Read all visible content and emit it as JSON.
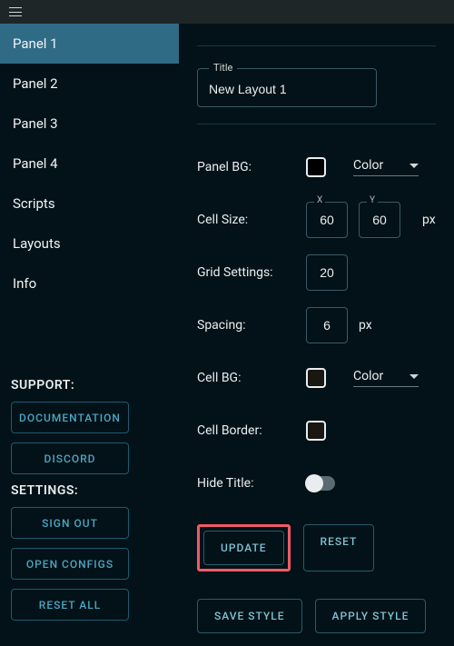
{
  "topbar": {
    "menu_icon": "hamburger-icon"
  },
  "sidebar": {
    "nav": [
      {
        "label": "Panel 1",
        "active": true
      },
      {
        "label": "Panel 2",
        "active": false
      },
      {
        "label": "Panel 3",
        "active": false
      },
      {
        "label": "Panel 4",
        "active": false
      },
      {
        "label": "Scripts",
        "active": false
      },
      {
        "label": "Layouts",
        "active": false
      },
      {
        "label": "Info",
        "active": false
      }
    ],
    "support": {
      "heading": "SUPPORT:",
      "buttons": [
        "DOCUMENTATION",
        "DISCORD"
      ]
    },
    "settings": {
      "heading": "SETTINGS:",
      "buttons": [
        "SIGN OUT",
        "OPEN CONFIGS",
        "RESET ALL"
      ]
    }
  },
  "form": {
    "title_legend": "Title",
    "title_value": "New Layout 1",
    "panel_bg": {
      "label": "Panel BG:",
      "swatch": "#000000",
      "mode": "Color"
    },
    "cell_size": {
      "label": "Cell Size:",
      "x_legend": "X",
      "y_legend": "Y",
      "x": "60",
      "y": "60",
      "unit": "px"
    },
    "grid": {
      "label": "Grid Settings:",
      "value": "20"
    },
    "spacing": {
      "label": "Spacing:",
      "value": "6",
      "unit": "px"
    },
    "cell_bg": {
      "label": "Cell BG:",
      "swatch": "#1a1612",
      "mode": "Color"
    },
    "cell_border": {
      "label": "Cell Border:",
      "swatch": "#1a1612"
    },
    "hide_title": {
      "label": "Hide Title:",
      "on": false
    },
    "actions": {
      "update": "UPDATE",
      "reset": "RESET",
      "save_style": "SAVE STYLE",
      "apply_style": "APPLY STYLE"
    }
  },
  "highlight": "update"
}
